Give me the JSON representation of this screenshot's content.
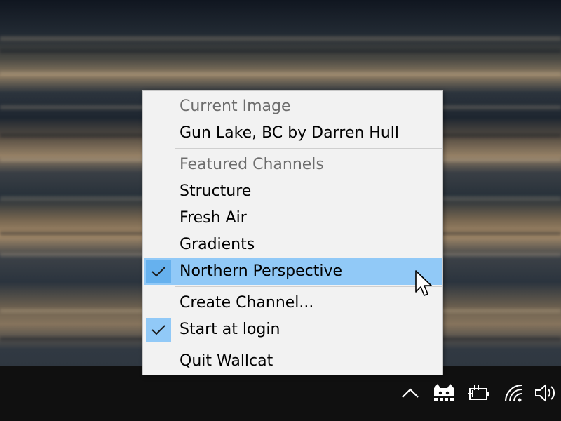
{
  "menu": {
    "current_image_header": "Current Image",
    "current_image_title": "Gun Lake, BC by Darren Hull",
    "featured_header": "Featured Channels",
    "channels": [
      {
        "label": "Structure",
        "checked": false
      },
      {
        "label": "Fresh Air",
        "checked": false
      },
      {
        "label": "Gradients",
        "checked": false
      },
      {
        "label": "Northern Perspective",
        "checked": true,
        "highlighted": true
      }
    ],
    "create_channel": "Create Channel...",
    "start_at_login": {
      "label": "Start at login",
      "checked": true
    },
    "quit": "Quit Wallcat"
  },
  "tray": {
    "icons": [
      "chevron-up-icon",
      "wallcat-cat-icon",
      "battery-plug-icon",
      "wifi-icon",
      "volume-icon"
    ]
  },
  "colors": {
    "menu_bg": "#f2f2f2",
    "highlight": "#91c9f7",
    "check_box": "#91c9f7",
    "header_text": "#6d6d6d",
    "taskbar": "#101010"
  }
}
